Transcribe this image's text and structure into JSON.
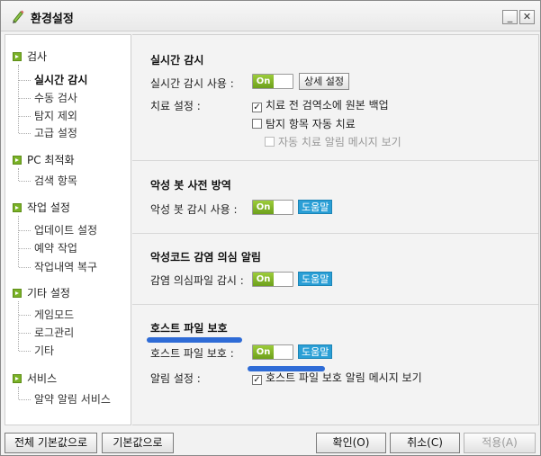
{
  "window": {
    "title": "환경설정",
    "minimize_label": "_",
    "close_label": "✕"
  },
  "sidebar": {
    "categories": [
      {
        "label": "검사",
        "items": [
          "실시간 감시",
          "수동 검사",
          "탐지 제외",
          "고급 설정"
        ],
        "selected": "실시간 감시"
      },
      {
        "label": "PC 최적화",
        "items": [
          "검색 항목"
        ]
      },
      {
        "label": "작업 설정",
        "items": [
          "업데이트 설정",
          "예약 작업",
          "작업내역 복구"
        ]
      },
      {
        "label": "기타 설정",
        "items": [
          "게임모드",
          "로그관리",
          "기타"
        ]
      },
      {
        "label": "서비스",
        "items": [
          "알약 알림 서비스"
        ]
      }
    ]
  },
  "sections": {
    "realtime": {
      "title": "실시간 감시",
      "use_label": "실시간 감시 사용 :",
      "toggle": "On",
      "detail_button": "상세 설정",
      "cure_label": "치료 설정 :",
      "opt1": "치료 전 검역소에 원본 백업",
      "opt1_checked": true,
      "opt2": "탐지 항목 자동 치료",
      "opt2_checked": false,
      "opt3": "자동 치료 알림 메시지 보기",
      "opt3_checked": false
    },
    "botnet": {
      "title": "악성 봇 사전 방역",
      "use_label": "악성 봇 감시 사용 :",
      "toggle": "On",
      "help": "도움말"
    },
    "infection": {
      "title": "악성코드 감염 의심 알림",
      "use_label": "감염 의심파일 감시 :",
      "toggle": "On",
      "help": "도움말"
    },
    "hosts": {
      "title": "호스트 파일 보호",
      "use_label": "호스트 파일 보호 :",
      "toggle": "On",
      "help": "도움말",
      "alert_label": "알림 설정 :",
      "alert_opt": "호스트 파일 보호 알림 메시지 보기",
      "alert_checked": true
    }
  },
  "footer": {
    "reset_all": "전체 기본값으로",
    "reset": "기본값으로",
    "ok": "확인(O)",
    "cancel": "취소(C)",
    "apply": "적용(A)"
  },
  "colors": {
    "toggle_on": "#7ab227",
    "help_blue": "#2a9fd6",
    "annotation": "#2e6bd6"
  }
}
